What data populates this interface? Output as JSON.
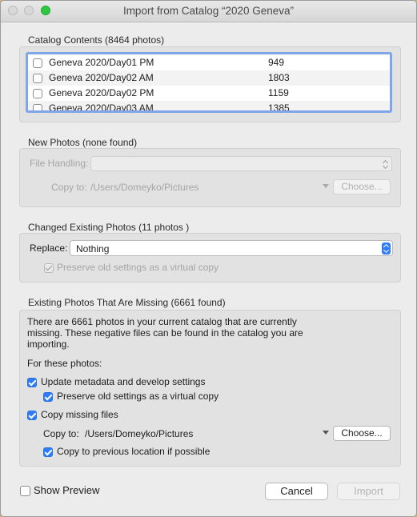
{
  "window": {
    "title": "Import from Catalog “2020 Geneva”"
  },
  "catalog": {
    "label": "Catalog Contents (8464 photos)",
    "rows": [
      {
        "name": "Geneva 2020/Day01 PM",
        "count": "949",
        "checked": false
      },
      {
        "name": "Geneva 2020/Day02 AM",
        "count": "1803",
        "checked": false
      },
      {
        "name": "Geneva 2020/Day02 PM",
        "count": "1159",
        "checked": false
      },
      {
        "name": "Geneva 2020/Day03 AM",
        "count": "1385",
        "checked": false
      }
    ]
  },
  "new_photos": {
    "label": "New Photos (none found)",
    "file_handling_label": "File Handling:",
    "file_handling_value": "",
    "copy_to_label": "Copy to:",
    "copy_to_path": "/Users/Domeyko/Pictures",
    "choose_label": "Choose..."
  },
  "changed": {
    "label": "Changed Existing Photos (11 photos )",
    "replace_label": "Replace:",
    "replace_value": "Nothing",
    "preserve_label": "Preserve old settings as a virtual copy"
  },
  "missing": {
    "label": "Existing Photos That Are Missing (6661 found)",
    "description_lines": [
      "There are 6661 photos in your current catalog that are currently",
      "missing. These negative files can be found in the catalog you are",
      "importing."
    ],
    "for_these": "For these photos:",
    "update_label": "Update metadata and develop settings",
    "preserve_label": "Preserve old settings as a virtual copy",
    "copy_missing_label": "Copy missing files",
    "copy_to_label": "Copy to:",
    "copy_to_path": "/Users/Domeyko/Pictures",
    "choose_label": "Choose...",
    "copy_prev_label": "Copy to previous location if possible"
  },
  "footer": {
    "show_preview_label": "Show Preview",
    "cancel_label": "Cancel",
    "import_label": "Import"
  },
  "colors": {
    "accent": "#2f7df6",
    "list_focus": "#7ea6e9"
  }
}
